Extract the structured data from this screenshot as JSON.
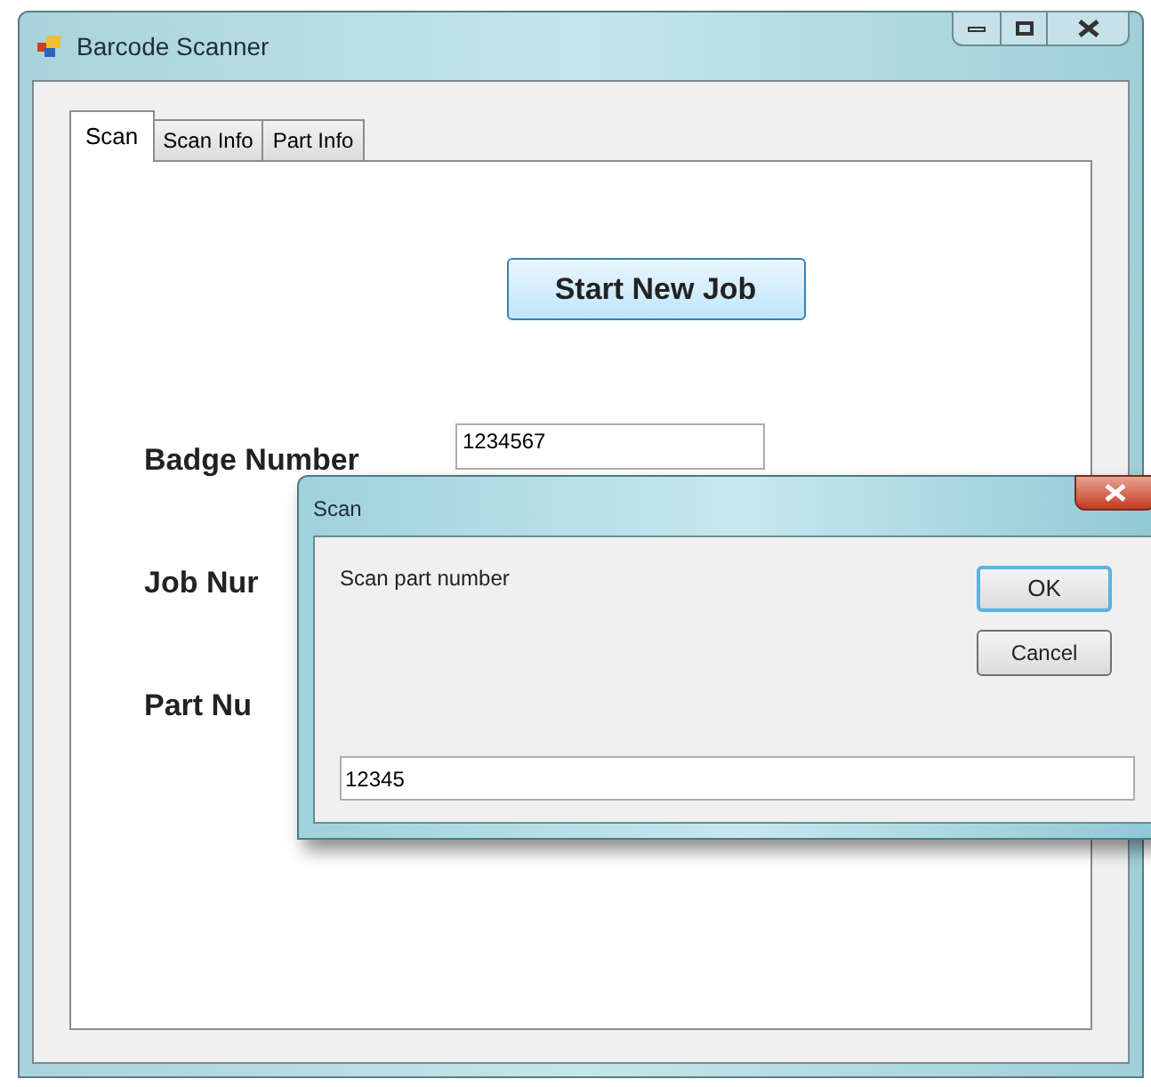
{
  "window": {
    "title": "Barcode Scanner"
  },
  "tabs": [
    {
      "label": "Scan",
      "selected": true
    },
    {
      "label": "Scan Info",
      "selected": false
    },
    {
      "label": "Part Info",
      "selected": false
    }
  ],
  "start_button": "Start New Job",
  "fields": [
    {
      "label": "Badge Number",
      "value": "1234567"
    },
    {
      "label": "Job Nur"
    },
    {
      "label": "Part Nu"
    }
  ],
  "dialog": {
    "title": "Scan",
    "prompt": "Scan part number",
    "buttons": [
      "OK",
      "Cancel"
    ],
    "value": "12345"
  }
}
